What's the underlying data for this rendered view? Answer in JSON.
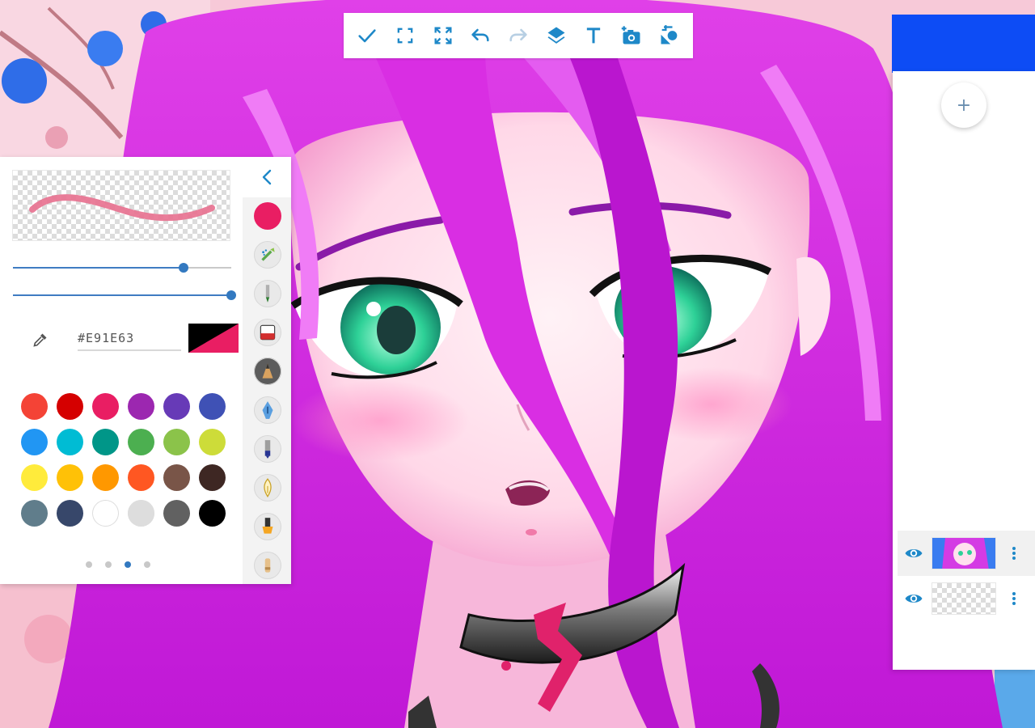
{
  "toolbar": {
    "buttons": [
      {
        "name": "confirm-icon"
      },
      {
        "name": "fit-screen-icon"
      },
      {
        "name": "fullscreen-icon"
      },
      {
        "name": "undo-icon"
      },
      {
        "name": "redo-icon"
      },
      {
        "name": "layers-icon"
      },
      {
        "name": "text-icon"
      },
      {
        "name": "add-photo-icon"
      },
      {
        "name": "shapes-icon"
      }
    ],
    "icon_color": "#1e88c8",
    "disabled_color": "#b7cfe3"
  },
  "layers": {
    "add_label": "+",
    "accent": "#0d4cf5",
    "items": [
      {
        "name": "artwork",
        "visible": true,
        "active": true
      },
      {
        "name": "empty",
        "visible": true,
        "active": false
      }
    ]
  },
  "brush": {
    "preview_color": "#e8708f",
    "size_fraction": 0.78,
    "opacity_fraction": 1.0,
    "hex_prefix": "#",
    "hex_value": "E91E63",
    "current_color": "#e91e63",
    "secondary_color": "#000000",
    "palette": [
      "#f44336",
      "#d50000",
      "#e91e63",
      "#9c27b0",
      "#673ab7",
      "#3f51b5",
      "#2196f3",
      "#00bcd4",
      "#009688",
      "#4caf50",
      "#8bc34a",
      "#cddc39",
      "#ffeb3b",
      "#ffc107",
      "#ff9800",
      "#ff5722",
      "#795548",
      "#3e2723",
      "#607d8b",
      "#37476a",
      "#ffffff",
      "#dddddd",
      "#616161",
      "#000000"
    ],
    "pages": 4,
    "active_page": 2,
    "tools": [
      {
        "name": "color-swatch-icon"
      },
      {
        "name": "airbrush-icon"
      },
      {
        "name": "marker-icon"
      },
      {
        "name": "eraser-icon"
      },
      {
        "name": "pencil-icon"
      },
      {
        "name": "fountain-pen-icon"
      },
      {
        "name": "ink-pen-icon"
      },
      {
        "name": "calligraphy-icon"
      },
      {
        "name": "highlighter-icon"
      },
      {
        "name": "crayon-icon"
      }
    ]
  }
}
